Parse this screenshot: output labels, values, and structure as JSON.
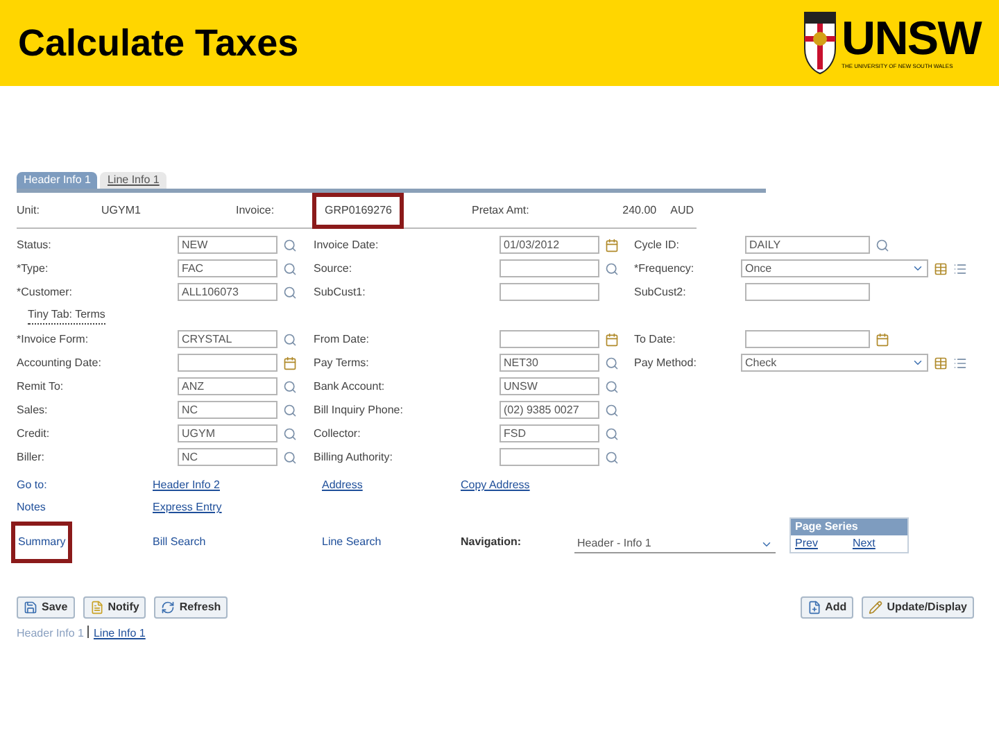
{
  "slide": {
    "title": "Calculate Taxes",
    "logo": "UNSW",
    "logo_tagline": "THE UNIVERSITY OF NEW SOUTH WALES"
  },
  "tabs": [
    {
      "label": "Header Info 1",
      "selected": true
    },
    {
      "label": "Line Info 1",
      "selected": false
    }
  ],
  "summary": [
    {
      "label": "Unit:",
      "value": "UGYM1",
      "highlighted": false
    },
    {
      "label": "Invoice:",
      "value": "GRP0169276",
      "highlighted": true
    },
    {
      "label": "Pretax Amt:",
      "value": "240.00",
      "currency": "AUD",
      "highlighted": false
    }
  ],
  "form_rows": [
    {
      "cells": [
        {
          "label": "Status:",
          "value": "NEW",
          "kind": "lookup"
        },
        {
          "label": "Invoice Date:",
          "value": "01/03/2012",
          "kind": "date"
        },
        {
          "label": "Cycle ID:",
          "value": "DAILY",
          "kind": "lookup"
        }
      ]
    },
    {
      "cells": [
        {
          "label": "*Type:",
          "value": "FAC",
          "kind": "lookup"
        },
        {
          "label": "Source:",
          "kind": "lookup"
        },
        {
          "label": "*Frequency:",
          "value": "Once",
          "kind": "select_extra"
        }
      ]
    },
    {
      "cells": [
        {
          "label": "*Customer:",
          "value": "ALL106073",
          "kind": "lookup"
        },
        {
          "label": "SubCust1:",
          "kind": "text"
        },
        {
          "label": "SubCust2:",
          "kind": "text"
        }
      ]
    },
    {
      "link": "Tiny Tab: Terms"
    },
    {
      "cells": [
        {
          "label": "*Invoice Form:",
          "value": "CRYSTAL",
          "kind": "lookup"
        },
        {
          "label": "From Date:",
          "kind": "date"
        },
        {
          "label": "To Date:",
          "kind": "date"
        }
      ]
    },
    {
      "cells": [
        {
          "label": "Accounting Date:",
          "kind": "date"
        },
        {
          "label": "Pay Terms:",
          "value": "NET30",
          "kind": "lookup"
        },
        {
          "label": "Pay Method:",
          "value": "Check",
          "kind": "select_extra"
        }
      ]
    },
    {
      "cells": [
        {
          "label": "Remit To:",
          "value": "ANZ",
          "kind": "lookup"
        },
        {
          "label": "Bank Account:",
          "value": "UNSW",
          "kind": "lookup"
        }
      ]
    },
    {
      "cells": [
        {
          "label": "Sales:",
          "value": "NC",
          "kind": "lookup"
        },
        {
          "label": "Bill Inquiry Phone:",
          "value": "(02) 9385 0027",
          "kind": "lookup"
        }
      ]
    },
    {
      "cells": [
        {
          "label": "Credit:",
          "value": "UGYM",
          "kind": "lookup"
        },
        {
          "label": "Collector:",
          "value": "FSD",
          "kind": "lookup"
        }
      ]
    },
    {
      "cells": [
        {
          "label": "Biller:",
          "value": "NC",
          "kind": "lookup"
        },
        {
          "label": "Billing Authority:",
          "kind": "lookup"
        }
      ]
    }
  ],
  "links_rows": [
    [
      {
        "text": "Go to:",
        "kind": "label"
      },
      {
        "text": "Header Info 2",
        "kind": "link"
      },
      {
        "text": "Address",
        "kind": "link"
      },
      {
        "text": "Copy Address",
        "kind": "link"
      }
    ],
    [
      {
        "text": "Notes",
        "kind": "label"
      },
      {
        "text": "Express Entry",
        "kind": "link"
      }
    ],
    [
      {
        "text": "Summary",
        "kind": "label",
        "highlighted": true
      },
      {
        "text": "Bill Search",
        "kind": "label"
      },
      {
        "text": "Line Search",
        "kind": "label"
      },
      {
        "text": "Navigation:",
        "kind": "bold"
      }
    ]
  ],
  "navigation": {
    "value": "Header - Info 1"
  },
  "page_series": {
    "title": "Page Series",
    "links": [
      "Prev",
      "Next"
    ]
  },
  "buttons_left": [
    {
      "label": "Save",
      "kind": "save"
    },
    {
      "label": "Notify",
      "kind": "notify"
    },
    {
      "label": "Refresh",
      "kind": "refresh"
    }
  ],
  "buttons_right": [
    {
      "label": "Add",
      "kind": "add"
    },
    {
      "label": "Update/Display",
      "kind": "update"
    }
  ],
  "footer_links": [
    {
      "text": "Header Info 1",
      "current": true
    },
    {
      "text": "Line Info 1",
      "current": false
    }
  ]
}
